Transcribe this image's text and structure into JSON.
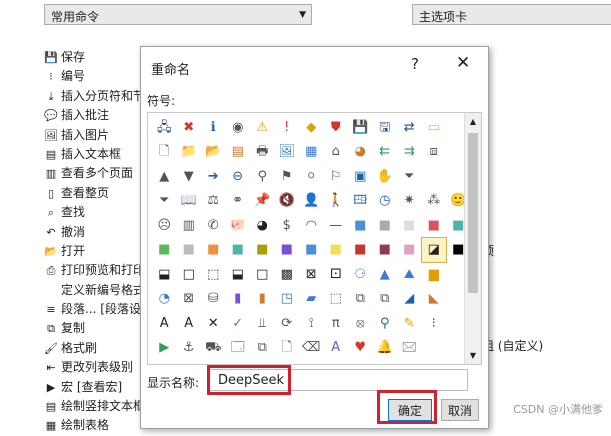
{
  "background": {
    "left_combo": {
      "value": "常用命令"
    },
    "right_combo": {
      "value": "主选项卡"
    },
    "commands": [
      {
        "icon": "save-icon",
        "glyph": "💾",
        "label": "保存"
      },
      {
        "icon": "numbering-icon",
        "glyph": "⁝",
        "label": "编号"
      },
      {
        "icon": "section-break-icon",
        "glyph": "⤓",
        "label": "插入分页符和节"
      },
      {
        "icon": "comment-icon",
        "glyph": "💬",
        "label": "插入批注"
      },
      {
        "icon": "picture-icon",
        "glyph": "🖼",
        "label": "插入图片"
      },
      {
        "icon": "textbox-icon",
        "glyph": "▤",
        "label": "插入文本框"
      },
      {
        "icon": "multi-page-icon",
        "glyph": "▥",
        "label": "查看多个页面"
      },
      {
        "icon": "whole-page-icon",
        "glyph": "▯",
        "label": "查看整页"
      },
      {
        "icon": "find-icon",
        "glyph": "⌕",
        "label": "查找"
      },
      {
        "icon": "undo-icon",
        "glyph": "↶",
        "label": "撤消"
      },
      {
        "icon": "open-icon",
        "glyph": "📂",
        "label": "打开"
      },
      {
        "icon": "print-preview-icon",
        "glyph": "⎙",
        "label": "打印预览和打印"
      },
      {
        "icon": "",
        "glyph": "",
        "label": "定义新编号格式"
      },
      {
        "icon": "paragraph-icon",
        "glyph": "≡",
        "label": "段落... [段落设置]"
      },
      {
        "icon": "copy-icon",
        "glyph": "⧉",
        "label": "复制"
      },
      {
        "icon": "format-painter-icon",
        "glyph": "🖌",
        "label": "格式刷"
      },
      {
        "icon": "list-level-icon",
        "glyph": "⇤",
        "label": "更改列表级别"
      },
      {
        "icon": "macro-icon",
        "glyph": "▶",
        "label": "宏 [查看宏]"
      },
      {
        "icon": "vertical-textbox-icon",
        "glyph": "▤",
        "label": "绘制竖排文本框"
      },
      {
        "icon": "draw-table-icon",
        "glyph": "▦",
        "label": "绘制表格"
      }
    ],
    "right_fragments": [
      {
        "text": "E"
      },
      {
        "text": "顶"
      },
      {
        "text": "组 (自定义)"
      }
    ],
    "watermark": "CSDN @小满他爹"
  },
  "dialog": {
    "title": "重命名",
    "help": "?",
    "close": "✕",
    "symbol_label": "符号:",
    "display_name_label": "显示名称:",
    "display_name_value": "DeepSeek",
    "ok_label": "确定",
    "cancel_label": "取消",
    "selected_symbol_index": 76,
    "symbols": [
      {
        "g": "🖧",
        "c": "#2a4d8a"
      },
      {
        "g": "✖",
        "c": "#d9342b"
      },
      {
        "g": "ℹ",
        "c": "#1f5fb3"
      },
      {
        "g": "◉",
        "c": "#555"
      },
      {
        "g": "⚠",
        "c": "#e0a000"
      },
      {
        "g": "!",
        "c": "#d9342b"
      },
      {
        "g": "◆",
        "c": "#e0a000"
      },
      {
        "g": "⛊",
        "c": "#d9342b"
      },
      {
        "g": "💾",
        "c": "#2a4d8a"
      },
      {
        "g": "🖫",
        "c": "#2a4d8a"
      },
      {
        "g": "⇄",
        "c": "#2a4d8a"
      },
      {
        "g": "▭",
        "c": "#e6b85c"
      },
      {
        "g": "",
        "c": "#000"
      },
      {
        "g": "🗋",
        "c": "#555"
      },
      {
        "g": "📁",
        "c": "#e0a000"
      },
      {
        "g": "📂",
        "c": "#e0a000"
      },
      {
        "g": "▤",
        "c": "#d07a2a"
      },
      {
        "g": "🖶",
        "c": "#555"
      },
      {
        "g": "🖼",
        "c": "#3a7bd5"
      },
      {
        "g": "▦",
        "c": "#3a7bd5"
      },
      {
        "g": "⌂",
        "c": "#555"
      },
      {
        "g": "◕",
        "c": "#d07a2a"
      },
      {
        "g": "⇇",
        "c": "#2e9e5b"
      },
      {
        "g": "⇉",
        "c": "#2e9e5b"
      },
      {
        "g": "⧈",
        "c": "#555"
      },
      {
        "g": "",
        "c": "#000"
      },
      {
        "g": "▲",
        "c": "#555"
      },
      {
        "g": "▼",
        "c": "#555"
      },
      {
        "g": "➔",
        "c": "#1f5fb3"
      },
      {
        "g": "⊖",
        "c": "#1f5fb3"
      },
      {
        "g": "⚲",
        "c": "#555"
      },
      {
        "g": "⚑",
        "c": "#555"
      },
      {
        "g": "⚪",
        "c": "#777"
      },
      {
        "g": "⚐",
        "c": "#1f5fb3"
      },
      {
        "g": "▣",
        "c": "#1f5fb3"
      },
      {
        "g": "✋",
        "c": "#555"
      },
      {
        "g": "⏷",
        "c": "#555"
      },
      {
        "g": "",
        "c": "#000"
      },
      {
        "g": "",
        "c": "#000"
      },
      {
        "g": "⏷",
        "c": "#555"
      },
      {
        "g": "📖",
        "c": "#1f5fb3"
      },
      {
        "g": "⚖",
        "c": "#555"
      },
      {
        "g": "⚭",
        "c": "#555"
      },
      {
        "g": "📌",
        "c": "#555"
      },
      {
        "g": "🔇",
        "c": "#555"
      },
      {
        "g": "👤",
        "c": "#555"
      },
      {
        "g": "🚶",
        "c": "#555"
      },
      {
        "g": "🖽",
        "c": "#3a7bd5"
      },
      {
        "g": "◷",
        "c": "#1f5fb3"
      },
      {
        "g": "✷",
        "c": "#555"
      },
      {
        "g": "⁂",
        "c": "#555"
      },
      {
        "g": "🙂",
        "c": "#e0a000"
      },
      {
        "g": "☹",
        "c": "#555"
      },
      {
        "g": "▥",
        "c": "#555"
      },
      {
        "g": "✆",
        "c": "#555"
      },
      {
        "g": "🐖",
        "c": "#555"
      },
      {
        "g": "◕",
        "c": "#222"
      },
      {
        "g": "$",
        "c": "#555"
      },
      {
        "g": "◠",
        "c": "#555"
      },
      {
        "g": "—",
        "c": "#555"
      },
      {
        "g": "■",
        "c": "#4a90d9"
      },
      {
        "g": "■",
        "c": "#aaa"
      },
      {
        "g": "■",
        "c": "#ddd"
      },
      {
        "g": "■",
        "c": "#d9555c"
      },
      {
        "g": "■",
        "c": "#4db6ac"
      },
      {
        "g": "■",
        "c": "#5cb85c"
      },
      {
        "g": "■",
        "c": "#bbb"
      },
      {
        "g": "■",
        "c": "#f0913a"
      },
      {
        "g": "■",
        "c": "#4db6ac"
      },
      {
        "g": "■",
        "c": "#a8a000"
      },
      {
        "g": "■",
        "c": "#7a4fd6"
      },
      {
        "g": "■",
        "c": "#4a90d9"
      },
      {
        "g": "■",
        "c": "#f0e050"
      },
      {
        "g": "■",
        "c": "#c0392b"
      },
      {
        "g": "■",
        "c": "#8e3a59"
      },
      {
        "g": "■",
        "c": "#e0a0c0"
      },
      {
        "g": "◪",
        "c": "#222"
      },
      {
        "g": "■",
        "c": "#000"
      },
      {
        "g": "⬓",
        "c": "#222"
      },
      {
        "g": "□",
        "c": "#222"
      },
      {
        "g": "⬚",
        "c": "#222"
      },
      {
        "g": "⬓",
        "c": "#222"
      },
      {
        "g": "□",
        "c": "#222"
      },
      {
        "g": "▩",
        "c": "#222"
      },
      {
        "g": "⊠",
        "c": "#222"
      },
      {
        "g": "⚀",
        "c": "#222"
      },
      {
        "g": "⚆",
        "c": "#3a7bd5"
      },
      {
        "g": "▲",
        "c": "#3a7bd5"
      },
      {
        "g": "⛰",
        "c": "#3a7bd5"
      },
      {
        "g": "▆",
        "c": "#e0a000"
      },
      {
        "g": "",
        "c": "#000"
      },
      {
        "g": "◔",
        "c": "#3a7bd5"
      },
      {
        "g": "⊠",
        "c": "#555"
      },
      {
        "g": "⛁",
        "c": "#555"
      },
      {
        "g": "▮",
        "c": "#7a4fd6"
      },
      {
        "g": "▮",
        "c": "#d07a2a"
      },
      {
        "g": "◳",
        "c": "#3a7bd5"
      },
      {
        "g": "▰",
        "c": "#3a7bd5"
      },
      {
        "g": "⬚",
        "c": "#555"
      },
      {
        "g": "⧉",
        "c": "#555"
      },
      {
        "g": "⧉",
        "c": "#555"
      },
      {
        "g": "◢",
        "c": "#1f5fb3"
      },
      {
        "g": "◣",
        "c": "#d07a2a"
      },
      {
        "g": "",
        "c": "#000"
      },
      {
        "g": "A",
        "c": "#222"
      },
      {
        "g": "A",
        "c": "#222"
      },
      {
        "g": "✕",
        "c": "#222"
      },
      {
        "g": "✓",
        "c": "#2e9e5b"
      },
      {
        "g": "⫫",
        "c": "#555"
      },
      {
        "g": "⟳",
        "c": "#555"
      },
      {
        "g": "⟟",
        "c": "#555"
      },
      {
        "g": "π",
        "c": "#555"
      },
      {
        "g": "⦻",
        "c": "#555"
      },
      {
        "g": "⚲",
        "c": "#1f5fb3"
      },
      {
        "g": "✎",
        "c": "#e0a000"
      },
      {
        "g": "⁝",
        "c": "#555"
      },
      {
        "g": "",
        "c": "#000"
      },
      {
        "g": "▶",
        "c": "#2e9e5b"
      },
      {
        "g": "⚓",
        "c": "#555"
      },
      {
        "g": "⛟",
        "c": "#555"
      },
      {
        "g": "🗔",
        "c": "#555"
      },
      {
        "g": "⧉",
        "c": "#555"
      },
      {
        "g": "🗋",
        "c": "#555"
      },
      {
        "g": "⌫",
        "c": "#555"
      },
      {
        "g": "A",
        "c": "#7a4fd6"
      },
      {
        "g": "♥",
        "c": "#d9342b"
      },
      {
        "g": "🔔",
        "c": "#555"
      },
      {
        "g": "🖂",
        "c": "#555"
      },
      {
        "g": "",
        "c": "#000"
      },
      {
        "g": "",
        "c": "#000"
      }
    ]
  }
}
